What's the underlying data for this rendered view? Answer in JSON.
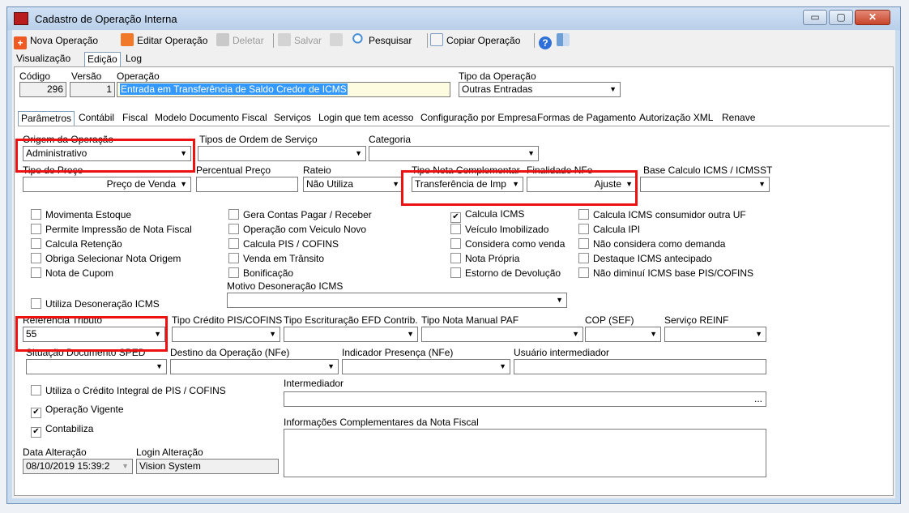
{
  "window": {
    "title": "Cadastro de Operação Interna",
    "minimize": "▭",
    "maximize": "▢",
    "close": "✕"
  },
  "toolbar": {
    "nova": "Nova Operação",
    "editar": "Editar Operação",
    "deletar": "Deletar",
    "salvar": "Salvar",
    "pesquisar": "Pesquisar",
    "copiar": "Copiar Operação"
  },
  "mainTabs": [
    "Visualização",
    "Edição",
    "Log"
  ],
  "header": {
    "codigo_label": "Código",
    "codigo_value": "296",
    "versao_label": "Versão",
    "versao_value": "1",
    "operacao_label": "Operação",
    "operacao_value": "Entrada em Transferência de Saldo Credor de ICMS",
    "tipo_label": "Tipo da Operação",
    "tipo_value": "Outras Entradas"
  },
  "subTabs": [
    "Parâmetros",
    "Contábil",
    "Fiscal",
    "Modelo Documento Fiscal",
    "Serviços",
    "Login que tem acesso",
    "Configuração por Empresa",
    "Formas de Pagamento",
    "Autorização XML",
    "Renave"
  ],
  "params": {
    "origem_label": "Origem da Operação",
    "origem_value": "Administrativo",
    "tipos_os_label": "Tipos de Ordem de Serviço",
    "tipos_os_value": "",
    "categoria_label": "Categoria",
    "categoria_value": "",
    "tipo_preco_label": "Tipo do Preço",
    "tipo_preco_value": "Preço de Venda",
    "percentual_label": "Percentual Preço",
    "percentual_value": "",
    "rateio_label": "Rateio",
    "rateio_value": "Não Utiliza",
    "tipo_nota_label": "Tipo Nota Complementar",
    "tipo_nota_value": "Transferência de Imp",
    "finalidade_label": "Finalidade NFe",
    "finalidade_value": "Ajuste",
    "base_calc_label": "Base Calculo ICMS / ICMSST",
    "base_calc_value": "",
    "motivo_label": "Motivo Desoneração ICMS",
    "motivo_value": "",
    "ref_trib_label": "Referência Tributo",
    "ref_trib_value": "55",
    "tipo_credito_label": "Tipo Crédito PIS/COFINS",
    "tipo_escrit_label": "Tipo Escrituração EFD Contrib.",
    "tipo_nota_manual_label": "Tipo Nota Manual PAF",
    "cop_label": "COP (SEF)",
    "servico_reinf_label": "Serviço REINF",
    "situacao_label": "Situação Documento SPED",
    "destino_label": "Destino da Operação (NFe)",
    "indicador_label": "Indicador Presença (NFe)",
    "usuario_label": "Usuário intermediador",
    "intermediador_label": "Intermediador",
    "intermediador_btn": "...",
    "info_label": "Informações Complementares da Nota Fiscal",
    "data_alt_label": "Data Alteração",
    "data_alt_value": "08/10/2019 15:39:2",
    "login_alt_label": "Login Alteração",
    "login_alt_value": "Vision System"
  },
  "checkboxes": [
    {
      "label": "Movimenta Estoque",
      "checked": false
    },
    {
      "label": "Permite Impressão de Nota Fiscal",
      "checked": false
    },
    {
      "label": "Calcula Retenção",
      "checked": false
    },
    {
      "label": "Obriga Selecionar Nota Origem",
      "checked": false
    },
    {
      "label": "Nota de Cupom",
      "checked": false
    },
    {
      "label": "Gera Contas Pagar / Receber",
      "checked": false
    },
    {
      "label": "Operação com Veiculo Novo",
      "checked": false
    },
    {
      "label": "Calcula PIS / COFINS",
      "checked": false
    },
    {
      "label": "Venda em Trânsito",
      "checked": false
    },
    {
      "label": "Bonificação",
      "checked": false
    },
    {
      "label": "Calcula ICMS",
      "checked": true
    },
    {
      "label": "Veículo Imobilizado",
      "checked": false
    },
    {
      "label": "Considera como venda",
      "checked": false
    },
    {
      "label": "Nota Própria",
      "checked": false
    },
    {
      "label": "Estorno de Devolução",
      "checked": false
    },
    {
      "label": "Calcula ICMS consumidor outra UF",
      "checked": false
    },
    {
      "label": "Calcula IPI",
      "checked": false
    },
    {
      "label": "Não considera como demanda",
      "checked": false
    },
    {
      "label": "Destaque ICMS antecipado",
      "checked": false
    },
    {
      "label": "Não diminuí ICMS base PIS/COFINS",
      "checked": false
    },
    {
      "label": "Utiliza Desoneração ICMS",
      "checked": false
    },
    {
      "label": "Utiliza o Crédito Integral de PIS / COFINS",
      "checked": false
    },
    {
      "label": "Operação Vigente",
      "checked": true
    },
    {
      "label": "Contabiliza",
      "checked": true
    }
  ],
  "colors": {
    "highlight": "#e11111",
    "selection": "#3399ff"
  }
}
